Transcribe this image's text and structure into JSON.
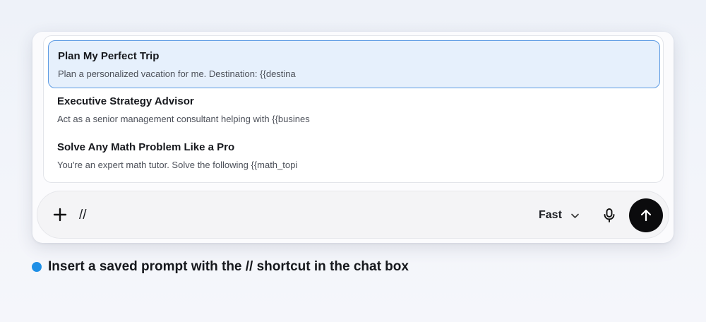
{
  "prompt_suggestions": [
    {
      "title": "Plan My Perfect Trip",
      "description": "Plan a personalized vacation for me. Destination: {{destina",
      "highlighted": true
    },
    {
      "title": "Executive Strategy Advisor",
      "description": "Act as a senior management consultant helping with {{busines",
      "highlighted": false
    },
    {
      "title": "Solve Any Math Problem Like a Pro",
      "description": "You're an expert math tutor. Solve the following {{math_topi",
      "highlighted": false
    }
  ],
  "composer": {
    "input_value": "//",
    "add_icon": "plus-icon",
    "model": "Fast",
    "model_icon": "chevron-down-icon",
    "mic_icon": "microphone-icon",
    "send_icon": "arrow-up-icon"
  },
  "caption": {
    "text": "Insert a saved prompt with the // shortcut in the chat box",
    "dot_color": "#1e8fe6"
  },
  "colors": {
    "highlight_bg": "#e6f0fc",
    "highlight_border": "#5d9be3",
    "send_button": "#0b0b0d"
  }
}
